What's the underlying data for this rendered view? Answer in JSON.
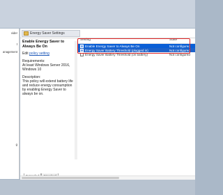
{
  "left_tree": {
    "items": [
      "vider",
      "t",
      "anagement",
      "",
      "",
      "",
      "",
      "",
      "g",
      "",
      "",
      ""
    ]
  },
  "header": {
    "title": "Energy Saver Settings"
  },
  "description": {
    "title": "Enable Energy Saver to Always Be On",
    "edit_prefix": "Edit",
    "edit_link": "policy setting",
    "requirements_label": "Requirements:",
    "requirements_text": "At least Windows Server 2016, Windows 10",
    "description_label": "Description:",
    "description_text": "This policy will extend battery life and reduce energy consumption by enabling Energy Saver to always be on."
  },
  "list": {
    "col_setting": "Setting",
    "col_state": "State",
    "rows": [
      {
        "setting": "Enable Energy Saver to Always Be On",
        "state": "Not configured"
      },
      {
        "setting": "Energy Saver Battery Threshold (plugged in)",
        "state": "Not configured"
      },
      {
        "setting": "Energy Saver Battery Threshold (on battery)",
        "state": "Not configured"
      }
    ]
  },
  "tabs": {
    "extended": "Extended",
    "standard": "Standard"
  },
  "colors": {
    "selection": "#0a5fd6",
    "highlight_box": "#e02727"
  }
}
